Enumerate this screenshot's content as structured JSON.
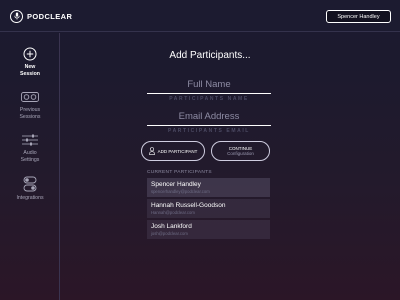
{
  "header": {
    "brand": "PODCLEAR",
    "user": "Spencer Handley"
  },
  "sidebar": {
    "items": [
      {
        "label": "New Session",
        "icon": "plus-circle-icon",
        "active": true
      },
      {
        "label": "Previous Sessions",
        "icon": "tape-icon",
        "active": false
      },
      {
        "label": "Audio Settings",
        "icon": "sliders-icon",
        "active": false
      },
      {
        "label": "Integrations",
        "icon": "toggles-icon",
        "active": false
      }
    ]
  },
  "main": {
    "title": "Add Participants...",
    "full_name": {
      "placeholder": "Full Name",
      "label": "PARTICIPANTS NAME"
    },
    "email": {
      "placeholder": "Email Address",
      "label": "PARTICIPANTS EMAIL"
    },
    "add_button": "ADD PARTICIPANT",
    "continue_button": {
      "label": "CONTINUE",
      "sub": "Configuration"
    },
    "current_label": "CURRENT PARTICIPANTS",
    "participants": [
      {
        "name": "Spencer Handley",
        "email": "spencerhandley@podclear.com"
      },
      {
        "name": "Hannah Russell-Goodson",
        "email": "Hannah@podclear.com"
      },
      {
        "name": "Josh Lankford",
        "email": "josh@podclear.com"
      }
    ]
  },
  "colors": {
    "background": "#1c1a30",
    "accent": "#ffffff",
    "muted": "#8e8ca4"
  }
}
